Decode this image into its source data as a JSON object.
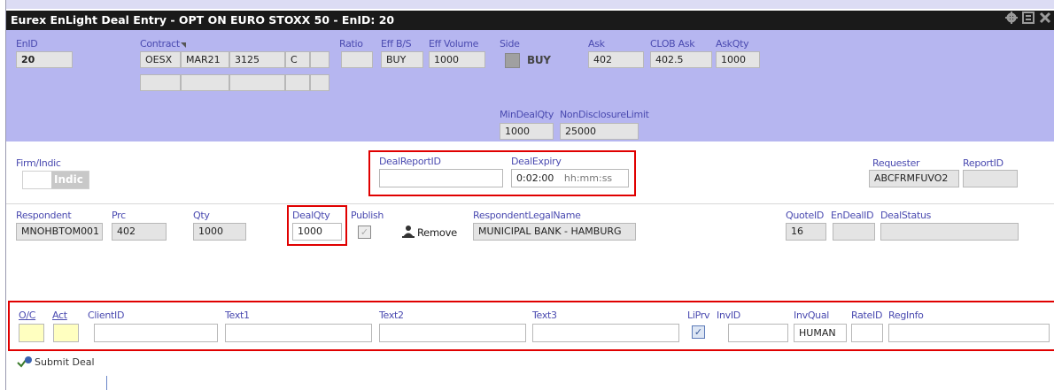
{
  "window": {
    "title": "Eurex EnLight Deal Entry - OPT ON EURO STOXX 50 - EnID: 20",
    "icons": [
      "gear-icon",
      "restore-icon",
      "close-icon"
    ]
  },
  "header": {
    "enid_label": "EnID",
    "enid_value": "20",
    "contract_label": "Contract",
    "contract_product": "OESX",
    "contract_expiry": "MAR21",
    "contract_strike": "3125",
    "contract_cp": "C",
    "ratio_label": "Ratio",
    "effbs_label": "Eff B/S",
    "effbs_value": "BUY",
    "effvol_label": "Eff Volume",
    "effvol_value": "1000",
    "side_label": "Side",
    "side_value": "BUY",
    "ask_label": "Ask",
    "ask_value": "402",
    "clobask_label": "CLOB Ask",
    "clobask_value": "402.5",
    "askqty_label": "AskQty",
    "askqty_value": "1000",
    "mindealqty_label": "MinDealQty",
    "mindealqty_value": "1000",
    "nondisclosure_label": "NonDisclosureLimit",
    "nondisclosure_value": "25000"
  },
  "firm": {
    "firm_indic_label": "Firm/Indic",
    "toggle_value": "Indic",
    "dealreportid_label": "DealReportID",
    "dealreportid_value": "",
    "dealexpiry_label": "DealExpiry",
    "dealexpiry_value": "0:02:00",
    "dealexpiry_format": "hh:mm:ss",
    "requester_label": "Requester",
    "requester_value": "ABCFRMFUVO2",
    "reportid_label": "ReportID",
    "reportid_value": ""
  },
  "respondent": {
    "respondent_label": "Respondent",
    "respondent_value": "MNOHBTOM001",
    "prc_label": "Prc",
    "prc_value": "402",
    "qty_label": "Qty",
    "qty_value": "1000",
    "dealqty_label": "DealQty",
    "dealqty_value": "1000",
    "publish_label": "Publish",
    "publish_checked": true,
    "remove_label": "Remove",
    "legalname_label": "RespondentLegalName",
    "legalname_value": "MUNICIPAL BANK - HAMBURG",
    "quoteid_label": "QuoteID",
    "quoteid_value": "16",
    "endealid_label": "EnDealID",
    "endealid_value": "",
    "dealstatus_label": "DealStatus",
    "dealstatus_value": ""
  },
  "order": {
    "oc_label": "O/C",
    "act_label": "Act",
    "clientid_label": "ClientID",
    "text1_label": "Text1",
    "text2_label": "Text2",
    "text3_label": "Text3",
    "liprv_label": "LiPrv",
    "liprv_checked": true,
    "invid_label": "InvID",
    "invqual_label": "InvQual",
    "invqual_value": "HUMAN",
    "rateid_label": "RateID",
    "reginfo_label": "RegInfo"
  },
  "actions": {
    "submit_label": "Submit Deal"
  },
  "colors": {
    "header_bg": "#b6b6f0",
    "highlight_red": "#e00000",
    "label_blue": "#4a4ab0",
    "input_yellow": "#ffffc0"
  }
}
